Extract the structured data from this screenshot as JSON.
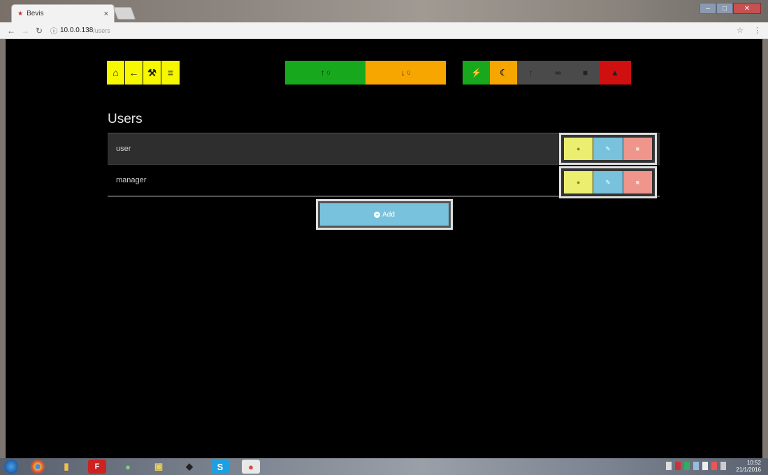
{
  "browser": {
    "tab_title": "Bevis",
    "tab_favicon": "★",
    "tab_close": "×",
    "url_host": "10.0.0.138",
    "url_path": "/users",
    "back_icon": "←",
    "forward_icon": "→",
    "reload_icon": "↻",
    "secure_icon": "ⓘ",
    "bookmark_icon": "☆",
    "menu_icon": "⋮",
    "min_icon": "–",
    "max_icon": "□",
    "close_icon": "✕"
  },
  "nav_buttons": [
    {
      "name": "home-icon",
      "glyph": "⌂"
    },
    {
      "name": "back-arrow-icon",
      "glyph": "←"
    },
    {
      "name": "wrench-icon",
      "glyph": "⚒"
    },
    {
      "name": "list-icon",
      "glyph": "≡"
    }
  ],
  "transfer": {
    "upload_glyph": "↑",
    "upload_count": "0",
    "download_glyph": "↓",
    "download_count": "0"
  },
  "status_icons": [
    {
      "name": "plug-icon",
      "glyph": "⚡",
      "class": "s-plug"
    },
    {
      "name": "moon-icon",
      "glyph": "☾",
      "class": "s-moon"
    },
    {
      "name": "pointer-icon",
      "glyph": "↑",
      "class": "s-gray"
    },
    {
      "name": "link-icon",
      "glyph": "∞",
      "class": "s-gray"
    },
    {
      "name": "lock-icon",
      "glyph": "■",
      "class": "s-gray"
    },
    {
      "name": "warning-icon",
      "glyph": "▲",
      "class": "s-alert"
    }
  ],
  "users_section": {
    "title": "Users",
    "add_label": "Add",
    "add_icon": "+"
  },
  "users": [
    {
      "name": "user"
    },
    {
      "name": "manager"
    }
  ],
  "row_action_glyphs": {
    "view": "●",
    "edit": "✎",
    "delete": "■"
  },
  "taskbar": {
    "clock_time": "10:52",
    "clock_date": "21/1/2016"
  },
  "colors": {
    "yellow": "#f7f700",
    "green": "#18a81e",
    "orange": "#f7a600",
    "red": "#d01010",
    "blue_action": "#78c2de",
    "pink_action": "#f0958c"
  }
}
